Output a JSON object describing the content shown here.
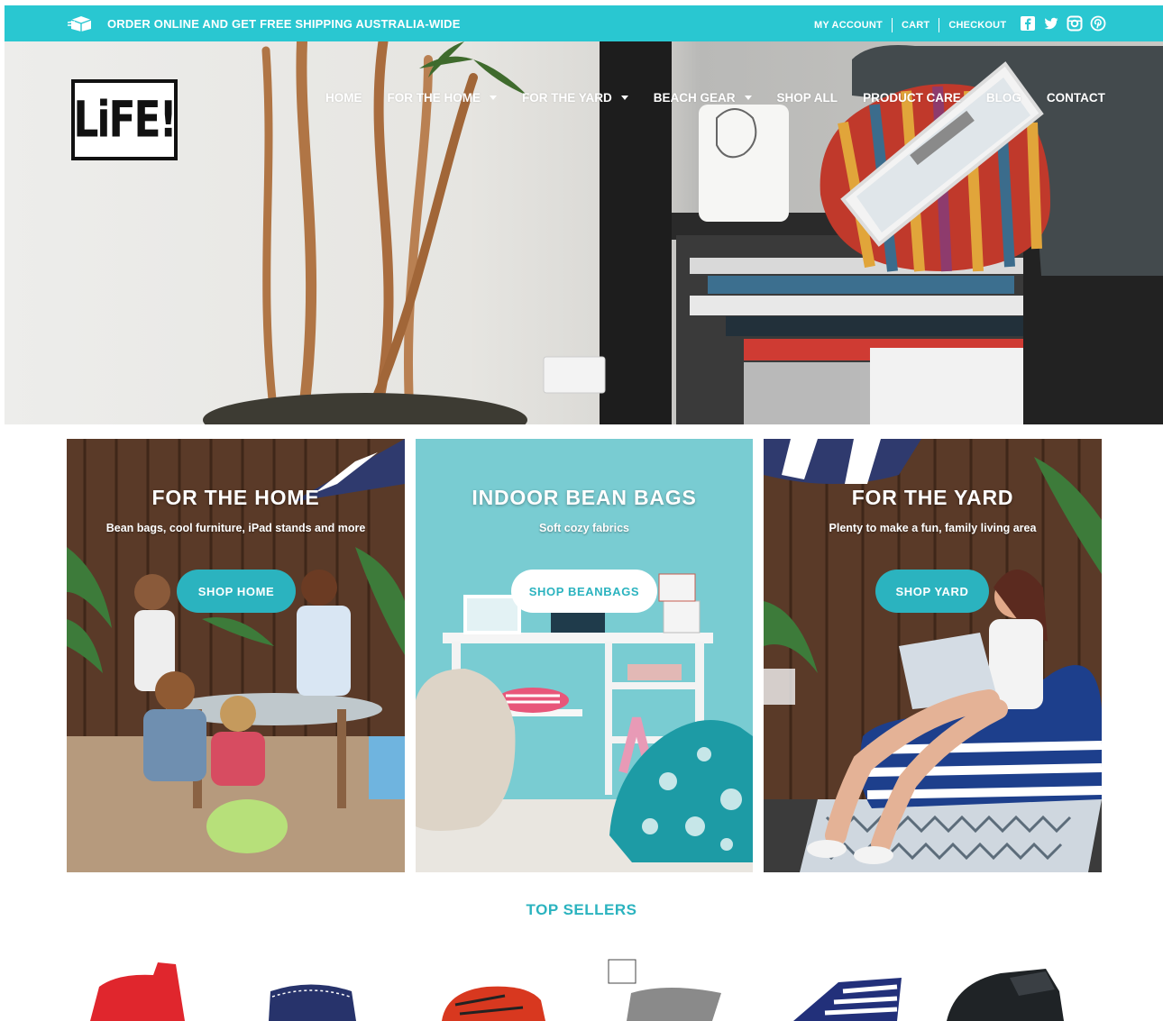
{
  "topbar": {
    "promo": "ORDER ONLINE AND GET FREE SHIPPING AUSTRALIA-WIDE",
    "links": [
      "MY ACCOUNT",
      "CART",
      "CHECKOUT"
    ],
    "social_icons": [
      "facebook-icon",
      "twitter-icon",
      "instagram-icon",
      "pinterest-icon"
    ],
    "color": "#29c7d1"
  },
  "logo": {
    "text": "LiFE!"
  },
  "nav": {
    "items": [
      {
        "label": "HOME",
        "dropdown": false
      },
      {
        "label": "FOR THE HOME",
        "dropdown": true
      },
      {
        "label": "FOR THE YARD",
        "dropdown": true
      },
      {
        "label": "BEACH GEAR",
        "dropdown": true
      },
      {
        "label": "SHOP ALL",
        "dropdown": false
      },
      {
        "label": "PRODUCT CARE",
        "dropdown": false
      },
      {
        "label": "BLOG",
        "dropdown": false
      },
      {
        "label": "CONTACT",
        "dropdown": false
      }
    ]
  },
  "panels": [
    {
      "title": "FOR THE HOME",
      "subtitle": "Bean bags, cool furniture, iPad stands and more",
      "button": "SHOP HOME"
    },
    {
      "title": "INDOOR BEAN BAGS",
      "subtitle": "Soft cozy fabrics",
      "button": "SHOP BEANBAGS"
    },
    {
      "title": "FOR THE YARD",
      "subtitle": "Plenty to make a fun, family living area",
      "button": "SHOP YARD"
    }
  ],
  "top_sellers": {
    "heading": "TOP SELLERS"
  },
  "colors": {
    "accent": "#2bb3bf",
    "topbar": "#29c7d1"
  }
}
